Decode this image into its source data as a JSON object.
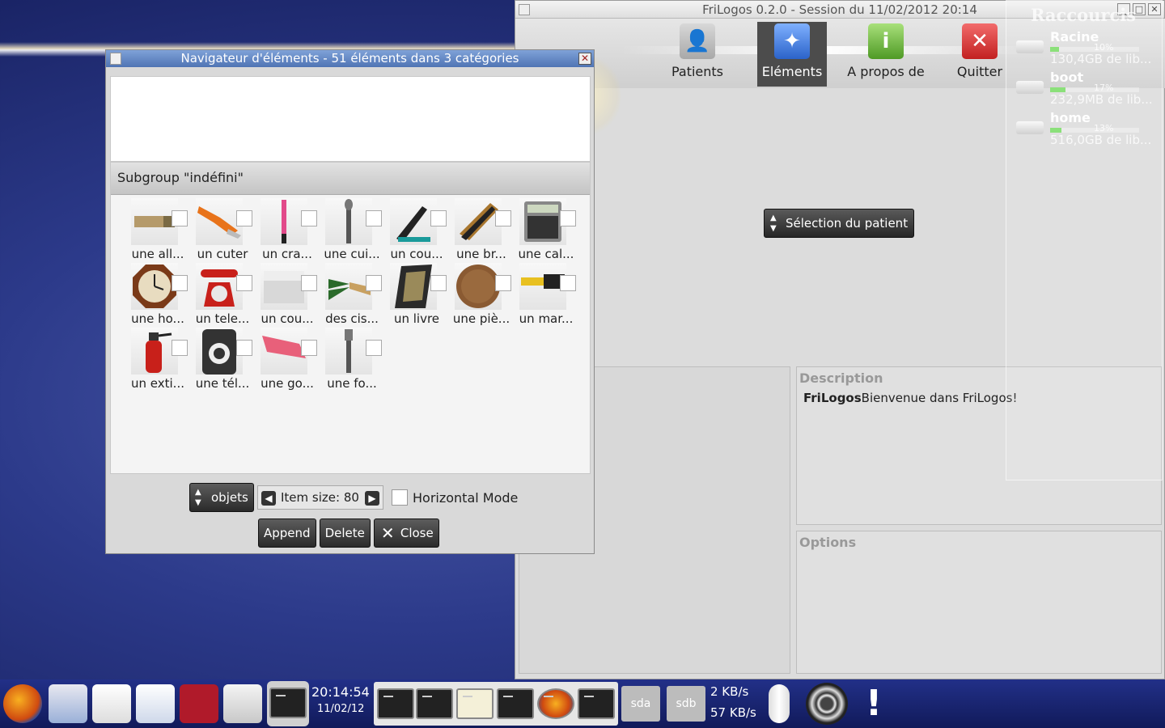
{
  "main_window": {
    "title": "FriLogos 0.2.0 - Session du 11/02/2012 20:14",
    "controls": [
      "_",
      "□",
      "✕"
    ],
    "toolbar": [
      {
        "label": "Patients",
        "icon": "patients-icon"
      },
      {
        "label": "Eléments",
        "icon": "elements-compass-icon",
        "active": true
      },
      {
        "label": "A propos de",
        "icon": "info-icon"
      },
      {
        "label": "Quitter",
        "icon": "quit-icon"
      }
    ],
    "patient_select_label": "Sélection du patient",
    "description_header": "Description",
    "description_brand": "FriLogos",
    "description_text": "Bienvenue dans FriLogos!",
    "options_header": "Options"
  },
  "raccourcis": {
    "title": "Raccourcis",
    "drives": [
      {
        "name": "Racine",
        "percent": "10%",
        "fill": 0.1,
        "free": "130,4GB de lib..."
      },
      {
        "name": "boot",
        "percent": "17%",
        "fill": 0.17,
        "free": "232,9MB de lib..."
      },
      {
        "name": "home",
        "percent": "13%",
        "fill": 0.13,
        "free": "516,0GB de lib..."
      }
    ]
  },
  "navigator": {
    "title": "Navigateur d'éléments - 51 éléments dans 3 catégories",
    "subgroup_header": "Subgroup \"indéfini\"",
    "items": [
      {
        "label": "une all...",
        "icon": "matches-icon"
      },
      {
        "label": "un cuter",
        "icon": "cutter-icon"
      },
      {
        "label": "un cra...",
        "icon": "pencil-icon"
      },
      {
        "label": "une cui...",
        "icon": "spoon-icon"
      },
      {
        "label": "un cou...",
        "icon": "nail-clipper-icon"
      },
      {
        "label": "une br...",
        "icon": "brush-icon"
      },
      {
        "label": "une cal...",
        "icon": "calculator-icon"
      },
      {
        "label": "une ho...",
        "icon": "clock-icon"
      },
      {
        "label": "un tele...",
        "icon": "telephone-icon"
      },
      {
        "label": "un cou...",
        "icon": "knife-icon"
      },
      {
        "label": "des cis...",
        "icon": "scissors-icon"
      },
      {
        "label": "un livre",
        "icon": "book-icon"
      },
      {
        "label": "une piè...",
        "icon": "coin-icon"
      },
      {
        "label": "un mar...",
        "icon": "hammer-icon"
      },
      {
        "label": "un exti...",
        "icon": "extinguisher-icon"
      },
      {
        "label": "une tél...",
        "icon": "remote-icon"
      },
      {
        "label": "une go...",
        "icon": "eraser-icon"
      },
      {
        "label": "une fo...",
        "icon": "fork-icon"
      }
    ],
    "category_select": "objets",
    "item_size_label": "Item size: 80",
    "horizontal_mode_label": "Horizontal Mode",
    "append_label": "Append",
    "delete_label": "Delete",
    "close_label": "Close"
  },
  "taskbar": {
    "clock_time": "20:14:54",
    "clock_date": "11/02/12",
    "dev_sda": "sda",
    "dev_sdb": "sdb",
    "net_up": "2 KB/s",
    "net_down": "57 KB/s",
    "apps": [
      "firefox-icon",
      "thunderbird-icon",
      "text-editor-icon",
      "document-viewer-icon",
      "filezilla-icon",
      "file-cabinet-icon",
      "terminal-icon"
    ],
    "tasks": [
      "system-monitor-icon",
      "terminal-icon",
      "notepad-icon",
      "terminal-icon",
      "firefox-icon",
      "terminal-icon"
    ],
    "tray": [
      "thermometer-icon",
      "speaker-icon",
      "warning-icon"
    ]
  }
}
